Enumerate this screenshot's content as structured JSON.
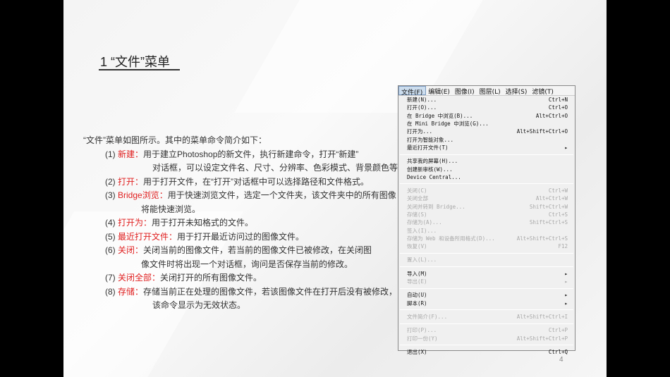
{
  "slide": {
    "title": "1  “文件”菜单",
    "intro": "“文件”菜单如图所示。其中的菜单命令简介如下：",
    "page_number": "4"
  },
  "items": [
    {
      "num": "(1) ",
      "term": "新建：",
      "desc": "用于建立Photoshop的新文件，执行新建命令，打开“新建”",
      "cont": "对话框，可以设定文件名、尺寸、分辨率、色彩模式、背景颜色等。"
    },
    {
      "num": "(2) ",
      "term": "打开：",
      "desc": "用于打开文件，在“打开”对话框中可以选择路径和文件格式。"
    },
    {
      "num": "(3) ",
      "term": "Bridge浏览：",
      "desc": "用于快速浏览文件，选定一个文件夹，该文件夹中的所有图像",
      "cont": "将能快速浏览。"
    },
    {
      "num": "(4) ",
      "term": "打开为：",
      "desc": "用于打开未知格式的文件。"
    },
    {
      "num": "(5) ",
      "term": "最近打开文件：",
      "desc": "用于打开最近访问过的图像文件。"
    },
    {
      "num": "(6) ",
      "term": "关闭：",
      "desc": "关闭当前的图像文件，若当前的图像文件已被修改，在关闭图",
      "cont": "像文件时将出现一个对话框，询问是否保存当前的修改。"
    },
    {
      "num": "(7) ",
      "term": "关闭全部：",
      "desc": "关闭打开的所有图像文件。"
    },
    {
      "num": "(8) ",
      "term": "存储：",
      "desc": "存储当前正在处理的图像文件，若该图像文件在打开后没有被修改，",
      "cont": "该命令显示为无效状态。"
    }
  ],
  "menubar": [
    "文件(F)",
    "编辑(E)",
    "图像(I)",
    "图层(L)",
    "选择(S)",
    "滤镜(T)"
  ],
  "menu": [
    {
      "label": "新建(N)...",
      "sc": "Ctrl+N"
    },
    {
      "label": "打开(O)...",
      "sc": "Ctrl+O"
    },
    {
      "label": "在 Bridge 中浏览(B)...",
      "sc": "Alt+Ctrl+O"
    },
    {
      "label": "在 Mini Bridge 中浏览(G)...",
      "sc": ""
    },
    {
      "label": "打开为...",
      "sc": "Alt+Shift+Ctrl+O"
    },
    {
      "label": "打开为智能对象...",
      "sc": ""
    },
    {
      "label": "最近打开文件(T)",
      "sc": "▸"
    },
    {
      "sep": true
    },
    {
      "label": "共享我的屏幕(H)...",
      "sc": ""
    },
    {
      "label": "创建新审核(W)...",
      "sc": ""
    },
    {
      "label": "Device Central...",
      "sc": ""
    },
    {
      "sep": true
    },
    {
      "label": "关闭(C)",
      "sc": "Ctrl+W",
      "dis": true
    },
    {
      "label": "关闭全部",
      "sc": "Alt+Ctrl+W",
      "dis": true
    },
    {
      "label": "关闭并转到 Bridge...",
      "sc": "Shift+Ctrl+W",
      "dis": true
    },
    {
      "label": "存储(S)",
      "sc": "Ctrl+S",
      "dis": true
    },
    {
      "label": "存储为(A)...",
      "sc": "Shift+Ctrl+S",
      "dis": true
    },
    {
      "label": "签入(I)...",
      "sc": "",
      "dis": true
    },
    {
      "label": "存储为 Web 和设备所用格式(D)...",
      "sc": "Alt+Shift+Ctrl+S",
      "dis": true
    },
    {
      "label": "恢复(V)",
      "sc": "F12",
      "dis": true
    },
    {
      "sep": true
    },
    {
      "label": "置入(L)...",
      "sc": "",
      "dis": true
    },
    {
      "sep": true
    },
    {
      "label": "导入(M)",
      "sc": "▸"
    },
    {
      "label": "导出(E)",
      "sc": "▸",
      "dis": true
    },
    {
      "sep": true
    },
    {
      "label": "自动(U)",
      "sc": "▸"
    },
    {
      "label": "脚本(R)",
      "sc": "▸"
    },
    {
      "sep": true
    },
    {
      "label": "文件简介(F)...",
      "sc": "Alt+Shift+Ctrl+I",
      "dis": true
    },
    {
      "sep": true
    },
    {
      "label": "打印(P)...",
      "sc": "Ctrl+P",
      "dis": true
    },
    {
      "label": "打印一份(Y)",
      "sc": "Alt+Shift+Ctrl+P",
      "dis": true
    },
    {
      "sep": true
    },
    {
      "label": "退出(X)",
      "sc": "Ctrl+Q"
    }
  ]
}
